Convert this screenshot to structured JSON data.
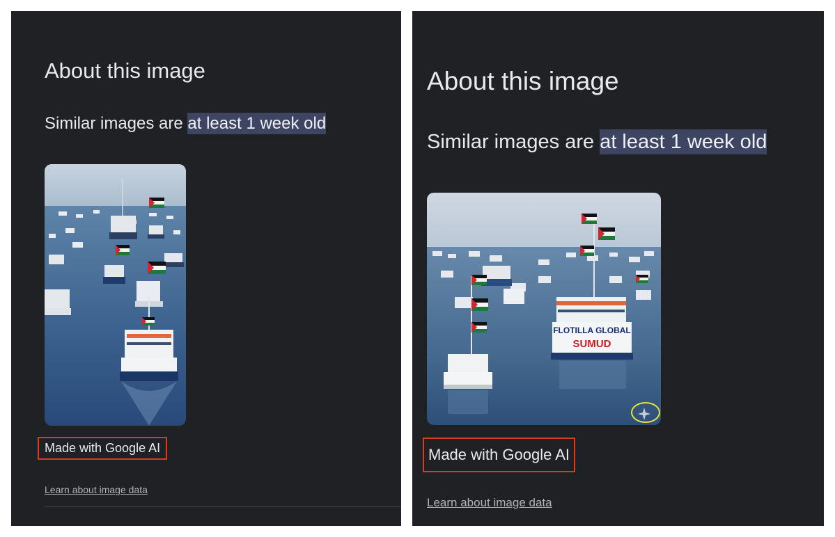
{
  "panels": [
    {
      "title": "About this image",
      "similar_prefix": "Similar images are ",
      "similar_highlight": "at least 1 week old",
      "made_with": "Made with Google AI",
      "learn_link": "Learn about image data"
    },
    {
      "title": "About this image",
      "similar_prefix": "Similar images are ",
      "similar_highlight": "at least 1 week old",
      "banner_line1": "FLOTILLA GLOBAL",
      "banner_line2": "SUMUD",
      "made_with": "Made with Google AI",
      "learn_link": "Learn about image data"
    }
  ],
  "icons": {
    "ai_indicator": "sparkle-icon",
    "flag": "palestinian-flag-icon"
  },
  "colors": {
    "panel_background": "#202124",
    "highlight_background": "#3e4561",
    "annotation_box": "#d63e22",
    "annotation_ring": "#e6e63a"
  }
}
